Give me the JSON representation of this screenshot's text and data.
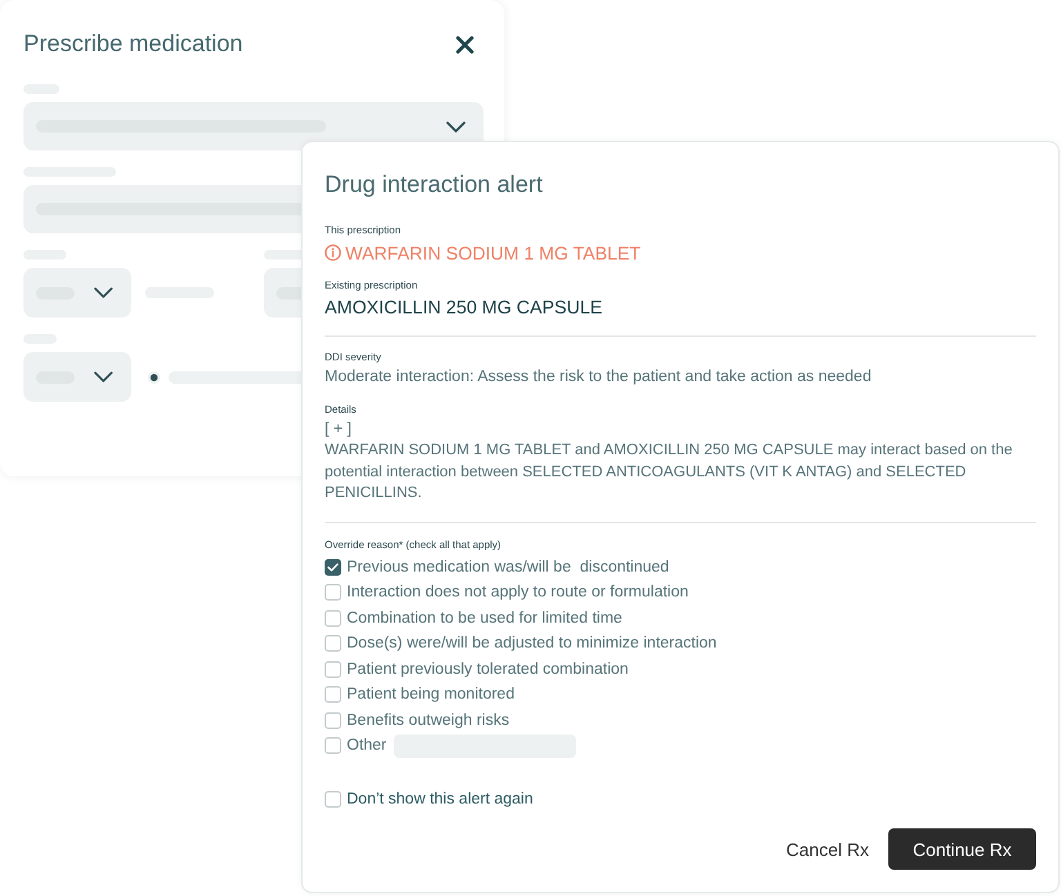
{
  "prescribe_form": {
    "title": "Prescribe medication",
    "rows": [
      {
        "kind": "select"
      },
      {
        "kind": "input"
      },
      {
        "kind": "select-pair"
      },
      {
        "kind": "select-slider"
      }
    ]
  },
  "alert": {
    "title": "Drug interaction alert",
    "this_prescription": {
      "label": "This prescription",
      "value": "WARFARIN SODIUM 1 MG TABLET"
    },
    "existing_prescription": {
      "label": "Existing prescription",
      "value": "AMOXICILLIN 250 MG CAPSULE"
    },
    "severity": {
      "label": "DDI severity",
      "value": "Moderate interaction: Assess the risk to the patient and take action as needed"
    },
    "details": {
      "label": "Details",
      "toggle": "[ + ]",
      "text": "WARFARIN SODIUM 1 MG TABLET and AMOXICILLIN 250 MG CAPSULE may interact based on the potential interaction between SELECTED ANTICOAGULANTS (VIT K ANTAG) and SELECTED PENICILLINS."
    },
    "override": {
      "label": "Override reason* (check all that apply)",
      "options": [
        {
          "label": "Previous medication was/will be  discontinued",
          "checked": true,
          "kind": "plain"
        },
        {
          "label": "Interaction does not apply to route or formulation",
          "checked": false,
          "kind": "plain"
        },
        {
          "label": "Combination to be used for limited time",
          "checked": false,
          "kind": "plain"
        },
        {
          "label": "Dose(s) were/will be adjusted to minimize interaction",
          "checked": false,
          "kind": "plain"
        },
        {
          "label": "Patient previously tolerated combination",
          "checked": false,
          "kind": "plain"
        },
        {
          "label": "Patient being monitored",
          "checked": false,
          "kind": "plain"
        },
        {
          "label": "Benefits outweigh risks",
          "checked": false,
          "kind": "plain"
        },
        {
          "label": "Other",
          "checked": false,
          "kind": "with-field"
        }
      ]
    },
    "dont_show": {
      "label": "Don’t show this alert again",
      "checked": false
    },
    "buttons": [
      {
        "label": "Cancel Rx",
        "kind": "text"
      },
      {
        "label": "Continue Rx",
        "kind": "primary"
      }
    ]
  }
}
